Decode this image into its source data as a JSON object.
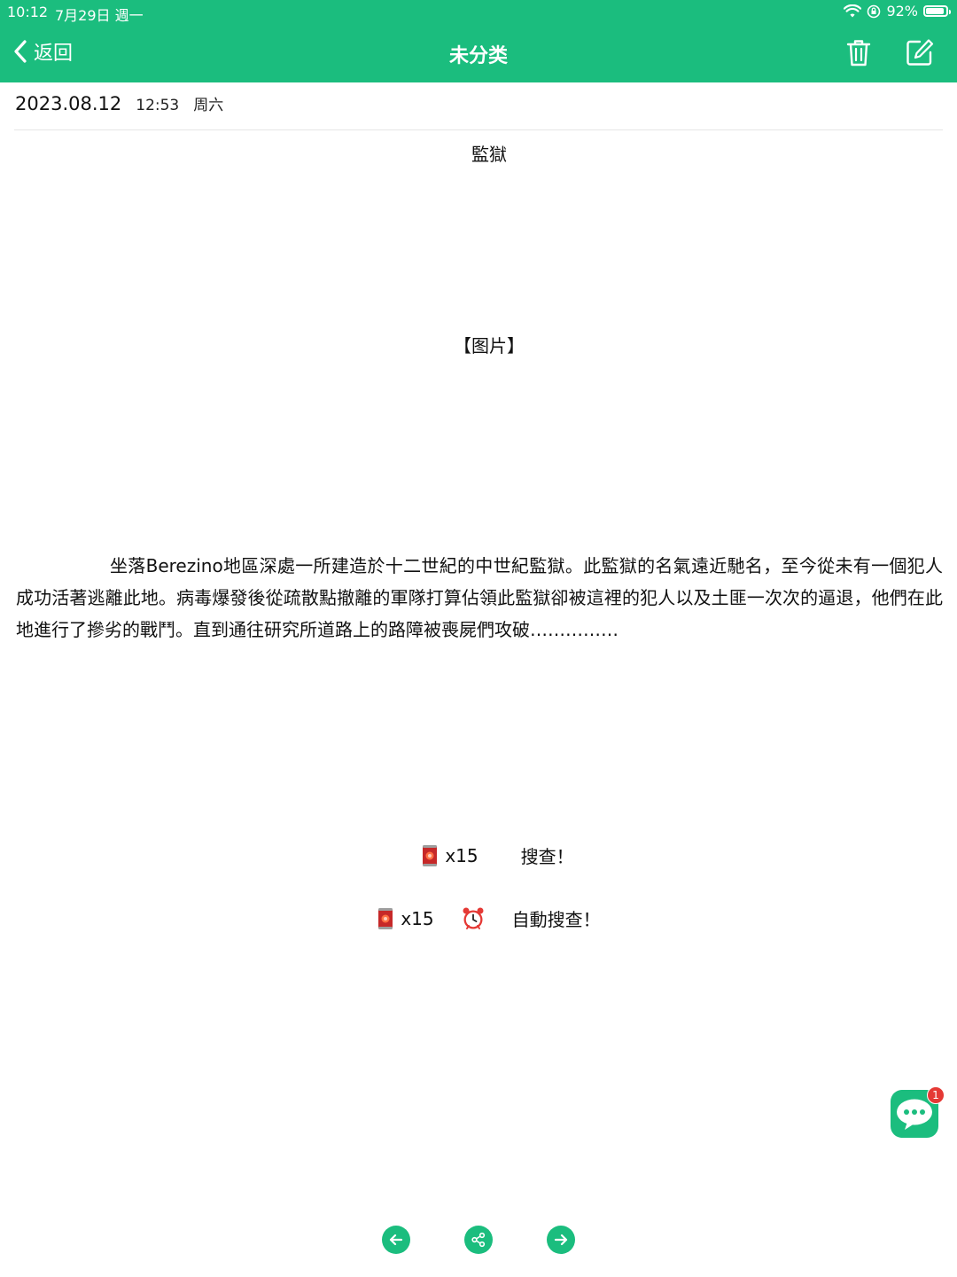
{
  "status_bar": {
    "time": "10:12",
    "date": "7月29日 週一",
    "battery": "92%",
    "battery_level": 0.92
  },
  "header": {
    "back_label": "返回",
    "title": "未分类"
  },
  "note": {
    "date": "2023.08.12",
    "time": "12:53",
    "weekday": "周六",
    "title": "監獄",
    "image_placeholder": "【图片】",
    "body": "坐落Berezino地區深處一所建造於十二世紀的中世紀監獄。此監獄的名氣遠近馳名，至今從未有一個犯人成功活著逃離此地。病毒爆發後從疏散點撤離的軍隊打算佔領此監獄卻被這裡的犯人以及土匪一次次的逼退，他們在此地進行了摻劣的戰鬥。直到通往研究所道路上的路障被喪屍們攻破……………"
  },
  "actions": {
    "search_cost": "x15",
    "search_label": "搜查！",
    "auto_cost": "x15",
    "auto_label": "自動搜查！"
  },
  "chat": {
    "badge": "1"
  },
  "colors": {
    "brand": "#1bbd7e",
    "badge": "#e53935"
  }
}
